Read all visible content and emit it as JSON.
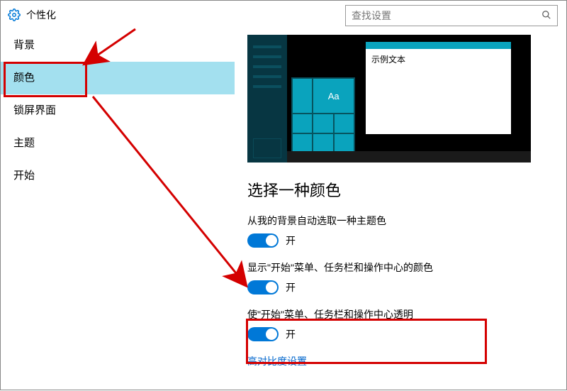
{
  "header": {
    "title": "个性化",
    "search_placeholder": "查找设置"
  },
  "sidebar": {
    "items": [
      {
        "label": "背景"
      },
      {
        "label": "颜色"
      },
      {
        "label": "锁屏界面"
      },
      {
        "label": "主题"
      },
      {
        "label": "开始"
      }
    ],
    "selected_index": 1
  },
  "preview": {
    "sample_text": "示例文本",
    "tile_label": "Aa"
  },
  "content": {
    "section_title": "选择一种颜色",
    "settings": [
      {
        "label": "从我的背景自动选取一种主题色",
        "state_label": "开"
      },
      {
        "label": "显示\"开始\"菜单、任务栏和操作中心的颜色",
        "state_label": "开"
      },
      {
        "label": "使\"开始\"菜单、任务栏和操作中心透明",
        "state_label": "开"
      }
    ],
    "high_contrast_link": "高对比度设置"
  }
}
